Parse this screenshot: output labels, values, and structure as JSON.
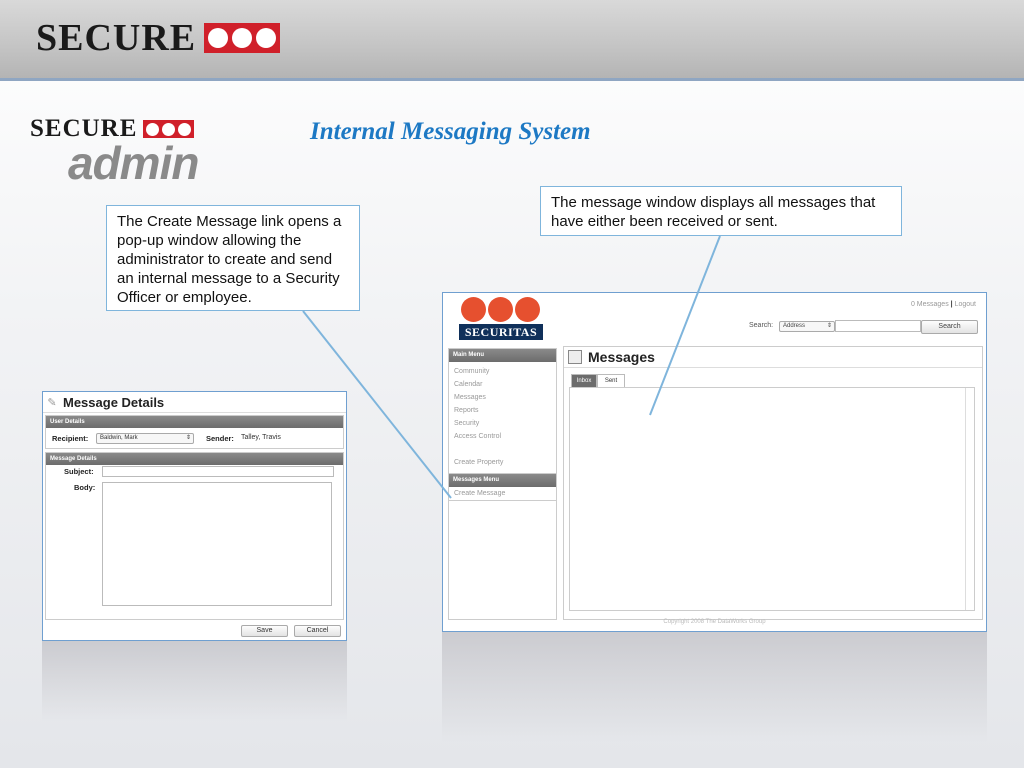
{
  "banner": {
    "logo_text": "SECURE"
  },
  "admin_logo": {
    "text": "SECURE",
    "word": "admin"
  },
  "slide_title": "Internal Messaging System",
  "callouts": {
    "create_message": "The Create Message link opens a pop-up window allowing the administrator to create and send an internal message to a Security Officer or employee.",
    "message_window": "The message window displays all messages that have either been received or sent."
  },
  "message_details": {
    "title": "Message Details",
    "user_details_header": "User Details",
    "recipient_label": "Recipient:",
    "recipient_value": "Baldwin, Mark",
    "sender_label": "Sender:",
    "sender_value": "Talley, Travis",
    "message_details_header": "Message Details",
    "subject_label": "Subject:",
    "body_label": "Body:",
    "save_label": "Save",
    "cancel_label": "Cancel"
  },
  "app": {
    "logo_name": "SECURITAS",
    "top_links": {
      "messages": "0 Messages",
      "separator": "|",
      "logout": "Logout"
    },
    "search": {
      "label": "Search:",
      "select_value": "Address",
      "button": "Search"
    },
    "main_menu_header": "Main Menu",
    "main_menu_items": [
      "Community",
      "Calendar",
      "Messages",
      "Reports",
      "Security",
      "Access Control"
    ],
    "create_property": "Create Property",
    "messages_menu_header": "Messages Menu",
    "create_message": "Create Message",
    "content_title": "Messages",
    "tabs": [
      "Inbox",
      "Sent"
    ],
    "footer": "Copyright 2008 The DataWorks Group"
  },
  "colors": {
    "brand_red": "#d0202a",
    "title_blue": "#1d79c4",
    "securitas_orange": "#e6502f",
    "securitas_navy": "#10305a"
  }
}
